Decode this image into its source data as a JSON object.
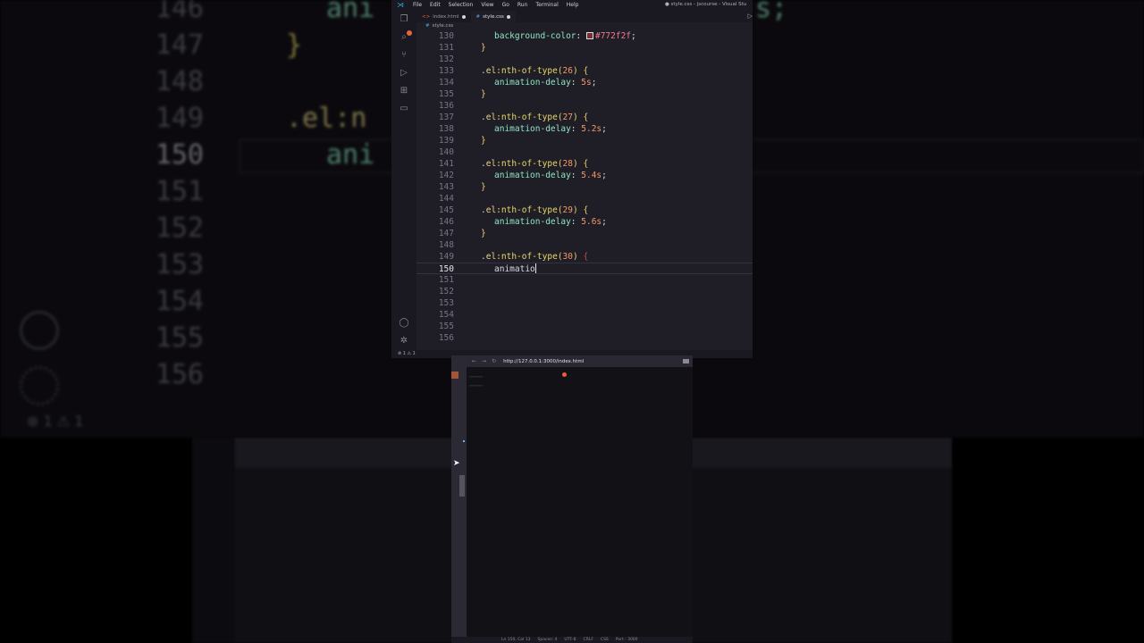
{
  "background": {
    "lines": [
      {
        "num": "146",
        "code": "ani"
      },
      {
        "num": "147",
        "code": "}"
      },
      {
        "num": "148",
        "code": ""
      },
      {
        "num": "149",
        "code": ".el:n"
      },
      {
        "num": "150",
        "code": "ani"
      },
      {
        "num": "151",
        "code": ""
      },
      {
        "num": "152",
        "code": ""
      },
      {
        "num": "153",
        "code": ""
      },
      {
        "num": "154",
        "code": ""
      },
      {
        "num": "155",
        "code": ""
      },
      {
        "num": "156",
        "code": ""
      }
    ],
    "right_fragment": "s;",
    "status": "⊗ 1 ⚠ 1"
  },
  "vscode": {
    "menu": [
      "File",
      "Edit",
      "Selection",
      "View",
      "Go",
      "Run",
      "Terminal",
      "Help"
    ],
    "window_title": "● style.css - jscourse - Visual Stu",
    "tabs": [
      {
        "label": "index.html",
        "icon": "html-icon",
        "state": "unsaved"
      },
      {
        "label": "style.css",
        "icon": "css-icon",
        "state": "unsaved"
      }
    ],
    "breadcrumb": "style.css",
    "current_line": "150",
    "status": "⊗ 1 ⚠ 1",
    "accent_colors": {
      "selector": "#e9d48b",
      "property": "#8fe6c4",
      "value": "#f09a6a",
      "bracket": "#f0d070",
      "hex_swatch": "#772f2f"
    }
  },
  "code_lines": [
    {
      "num": "130",
      "kind": "prop",
      "prop": "background-color",
      "value": "#772f2f",
      "swatch": true
    },
    {
      "num": "131",
      "kind": "close"
    },
    {
      "num": "132",
      "kind": "blank"
    },
    {
      "num": "133",
      "kind": "sel",
      "n": "26"
    },
    {
      "num": "134",
      "kind": "prop",
      "prop": "animation-delay",
      "value": "5s"
    },
    {
      "num": "135",
      "kind": "close"
    },
    {
      "num": "136",
      "kind": "blank"
    },
    {
      "num": "137",
      "kind": "sel",
      "n": "27"
    },
    {
      "num": "138",
      "kind": "prop",
      "prop": "animation-delay",
      "value": "5.2s"
    },
    {
      "num": "139",
      "kind": "close"
    },
    {
      "num": "140",
      "kind": "blank"
    },
    {
      "num": "141",
      "kind": "sel",
      "n": "28"
    },
    {
      "num": "142",
      "kind": "prop",
      "prop": "animation-delay",
      "value": "5.4s"
    },
    {
      "num": "143",
      "kind": "close"
    },
    {
      "num": "144",
      "kind": "blank"
    },
    {
      "num": "145",
      "kind": "sel",
      "n": "29"
    },
    {
      "num": "146",
      "kind": "prop",
      "prop": "animation-delay",
      "value": "5.6s"
    },
    {
      "num": "147",
      "kind": "close"
    },
    {
      "num": "148",
      "kind": "blank"
    },
    {
      "num": "149",
      "kind": "sel",
      "n": "30",
      "unmatched": true
    },
    {
      "num": "150",
      "kind": "typing",
      "text": "animatio"
    },
    {
      "num": "151",
      "kind": "blank"
    },
    {
      "num": "152",
      "kind": "blank"
    },
    {
      "num": "153",
      "kind": "blank"
    },
    {
      "num": "154",
      "kind": "blank"
    },
    {
      "num": "155",
      "kind": "blank"
    },
    {
      "num": "156",
      "kind": "blank"
    }
  ],
  "browser": {
    "url": "http://127.0.0.1:3000/index.html",
    "status_items": [
      "Ln 150, Col 13",
      "Spaces: 4",
      "UTF-8",
      "CRLF",
      "CSS",
      "Port : 3000"
    ]
  }
}
